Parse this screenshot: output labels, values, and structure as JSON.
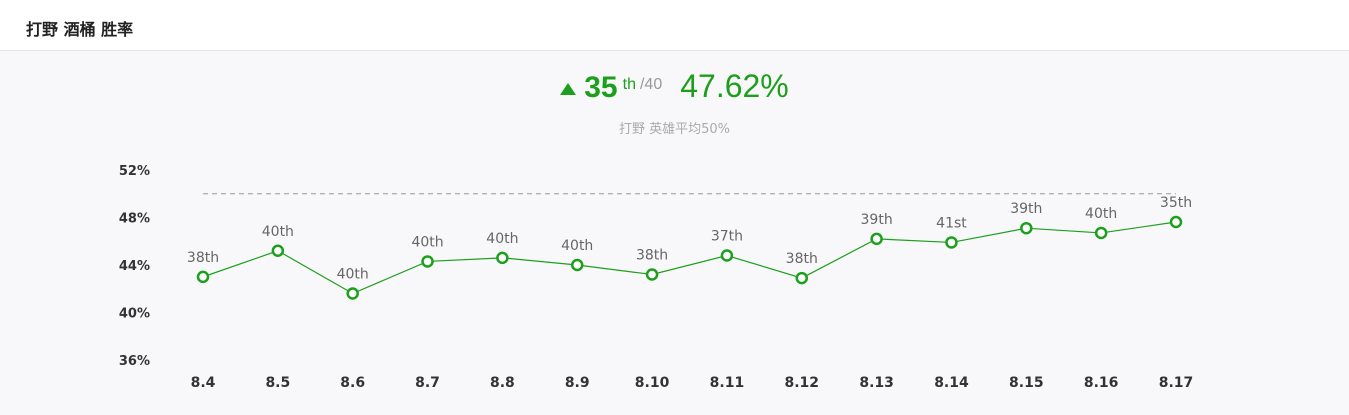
{
  "header": {
    "title": "打野 酒桶 胜率"
  },
  "summary": {
    "rank": "35",
    "rank_suffix": "th",
    "rank_total": "/40",
    "win_rate": "47.62%",
    "subtitle": "打野 英雄平均50%",
    "trend": "up",
    "trend_color": "#1c9f1c"
  },
  "chart_data": {
    "type": "line",
    "x": [
      "8.4",
      "8.5",
      "8.6",
      "8.7",
      "8.8",
      "8.9",
      "8.10",
      "8.11",
      "8.12",
      "8.13",
      "8.14",
      "8.15",
      "8.16",
      "8.17"
    ],
    "y_ticks": [
      "52%",
      "48%",
      "44%",
      "40%",
      "36%"
    ],
    "ylim": [
      36,
      52
    ],
    "series": [
      {
        "values": [
          43.0,
          45.2,
          41.6,
          44.3,
          44.6,
          44.0,
          43.2,
          44.8,
          42.9,
          46.2,
          45.9,
          47.1,
          46.7,
          47.62
        ],
        "labels": [
          "38th",
          "40th",
          "40th",
          "40th",
          "40th",
          "40th",
          "38th",
          "37th",
          "38th",
          "39th",
          "41st",
          "39th",
          "40th",
          "35th"
        ]
      }
    ],
    "reference_line": 50,
    "line_color": "#1c9f1c",
    "reference_color": "#999999"
  }
}
